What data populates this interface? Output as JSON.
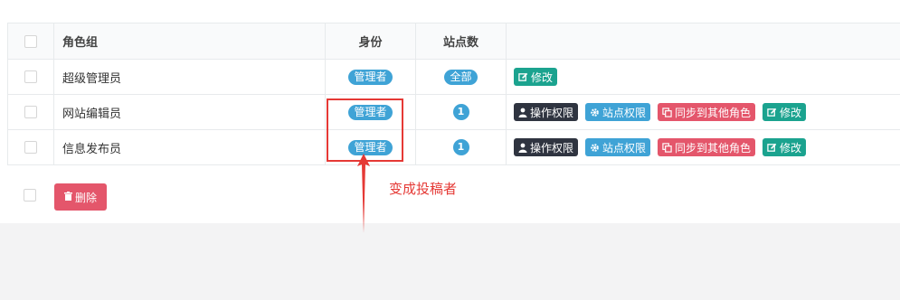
{
  "table": {
    "headers": {
      "role_group": "角色组",
      "identity": "身份",
      "site_count": "站点数"
    },
    "rows": [
      {
        "name": "超级管理员",
        "identity": "管理者",
        "sites": "全部",
        "actions": {
          "edit": "修改"
        }
      },
      {
        "name": "网站编辑员",
        "identity": "管理者",
        "sites": "1",
        "actions": {
          "op_perm": "操作权限",
          "site_perm": "站点权限",
          "sync": "同步到其他角色",
          "edit": "修改"
        }
      },
      {
        "name": "信息发布员",
        "identity": "管理者",
        "sites": "1",
        "actions": {
          "op_perm": "操作权限",
          "site_perm": "站点权限",
          "sync": "同步到其他角色",
          "edit": "修改"
        }
      }
    ]
  },
  "footer": {
    "delete_label": "删除"
  },
  "annotation": {
    "text": "变成投稿者",
    "color": "#e53935"
  },
  "colors": {
    "info": "#3fa3d6",
    "dark": "#2f3440",
    "danger": "#e4566b",
    "success": "#1ba38f"
  },
  "icons": {
    "edit": "pencil-square-icon",
    "op_perm": "user-icon",
    "site_perm": "gear-icon",
    "sync": "copy-icon",
    "delete": "trash-icon"
  }
}
